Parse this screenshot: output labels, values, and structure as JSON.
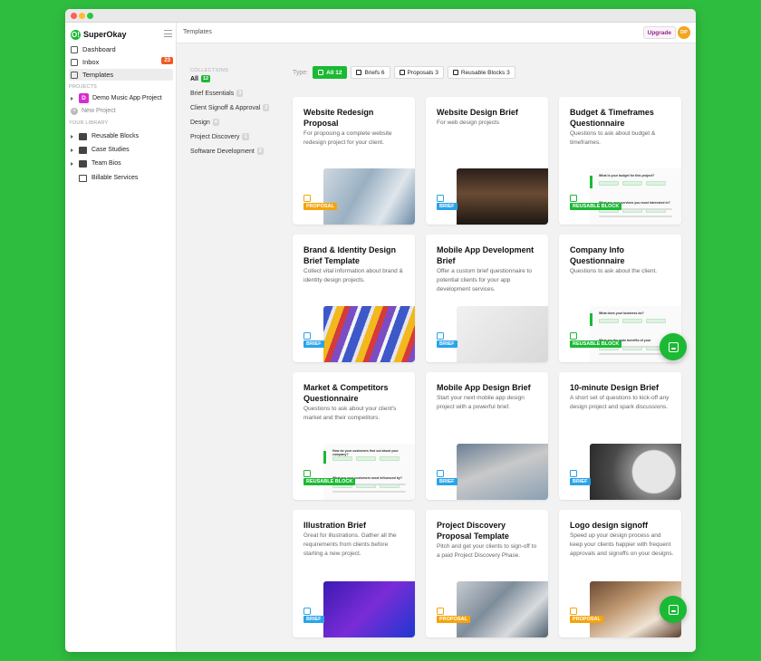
{
  "app": {
    "name": "SuperOkay",
    "logo_glyph": "O!"
  },
  "sidebar": {
    "nav": [
      {
        "label": "Dashboard",
        "icon": "dashboard-icon"
      },
      {
        "label": "Inbox",
        "icon": "inbox-icon",
        "badge": "23"
      },
      {
        "label": "Templates",
        "icon": "templates-icon",
        "active": true
      }
    ],
    "projects_heading": "PROJECTS",
    "projects": [
      {
        "label": "Demo Music App Project",
        "badge": "D"
      }
    ],
    "new_project_label": "New Project",
    "library_heading": "YOUR LIBRARY",
    "library": [
      {
        "label": "Reusable Blocks",
        "icon": "calendar-icon",
        "expandable": true
      },
      {
        "label": "Case Studies",
        "icon": "briefcase-icon",
        "expandable": true
      },
      {
        "label": "Team Bios",
        "icon": "id-card-icon",
        "expandable": true
      },
      {
        "label": "Billable Services",
        "icon": "receipt-icon",
        "expandable": false
      }
    ]
  },
  "header": {
    "title": "Templates",
    "upgrade_label": "Upgrade",
    "avatar_initials": "DP"
  },
  "collections": {
    "heading": "COLLECTIONS",
    "items": [
      {
        "label": "All",
        "count": "12",
        "active": true
      },
      {
        "label": "Brief Essentials",
        "count": "3"
      },
      {
        "label": "Client Signoff & Approval",
        "count": "2"
      },
      {
        "label": "Design",
        "count": "4"
      },
      {
        "label": "Project Discovery",
        "count": "1"
      },
      {
        "label": "Software Development",
        "count": "2"
      }
    ]
  },
  "filters": {
    "label": "Type:",
    "chips": [
      {
        "label": "All 12",
        "active": true
      },
      {
        "label": "Briefs 6"
      },
      {
        "label": "Proposals 3"
      },
      {
        "label": "Reusable Blocks 3"
      }
    ]
  },
  "templates": [
    {
      "title": "Website Redesign Proposal",
      "desc": "For proposing a complete website redesign project for your client.",
      "tag": "PROPOSAL",
      "kind": "proposal",
      "image": "office"
    },
    {
      "title": "Website Design Brief",
      "desc": "For web design projects",
      "tag": "BRIEF",
      "kind": "brief",
      "image": "laptop"
    },
    {
      "title": "Budget & Timeframes Questionnaire",
      "desc": "Questions to ask about budget & timeframes.",
      "tag": "REUSABLE BLOCK",
      "kind": "block",
      "image": "form"
    },
    {
      "title": "Brand & Identity Design Brief Template",
      "desc": "Collect vital information about brand & identity design projects.",
      "tag": "BRIEF",
      "kind": "brief",
      "image": "swatch"
    },
    {
      "title": "Mobile App Development Brief",
      "desc": "Offer a custom brief questionnaire to potential clients for your app development services.",
      "tag": "BRIEF",
      "kind": "brief",
      "image": "phone"
    },
    {
      "title": "Company Info Questionnaire",
      "desc": "Questions to ask about the client.",
      "tag": "REUSABLE BLOCK",
      "kind": "block",
      "image": "form"
    },
    {
      "title": "Market & Competitors Questionnaire",
      "desc": "Questions to ask about your client's market and their competitors.",
      "tag": "REUSABLE BLOCK",
      "kind": "block",
      "image": "form"
    },
    {
      "title": "Mobile App Design Brief",
      "desc": "Start your next mobile app design project with a powerful brief.",
      "tag": "BRIEF",
      "kind": "brief",
      "image": "hands"
    },
    {
      "title": "10-minute Design Brief",
      "desc": "A short set of questions to kick-off any design project and spark discussions.",
      "tag": "BRIEF",
      "kind": "brief",
      "image": "clock"
    },
    {
      "title": "Illustration Brief",
      "desc": "Great for illustrations. Gather all the requirements from clients before starting a new project.",
      "tag": "BRIEF",
      "kind": "brief",
      "image": "illus"
    },
    {
      "title": "Project Discovery Proposal Template",
      "desc": "Pitch and get your clients to sign-off to a paid Project Discovery Phase.",
      "tag": "PROPOSAL",
      "kind": "proposal",
      "image": "desk"
    },
    {
      "title": "Logo design signoff",
      "desc": "Speed up your design process and keep your clients happier with frequent approvals and signoffs on your designs.",
      "tag": "PROPOSAL",
      "kind": "proposal",
      "image": "sign"
    }
  ],
  "form_preview_text": {
    "budget": [
      "What is your budget for this project?",
      "What are your services you most interested in?"
    ],
    "company": [
      "What does your business do?",
      "What are the main benefits of your"
    ],
    "market": [
      "How do your customers find out about your company?",
      "What are your customers most influenced by?"
    ]
  },
  "colors": {
    "brand_green": "#1bb934",
    "background_green": "#2fbd3f",
    "proposal": "#f5a40a",
    "brief": "#2aa3e8",
    "reusable_block": "#1bb934"
  }
}
